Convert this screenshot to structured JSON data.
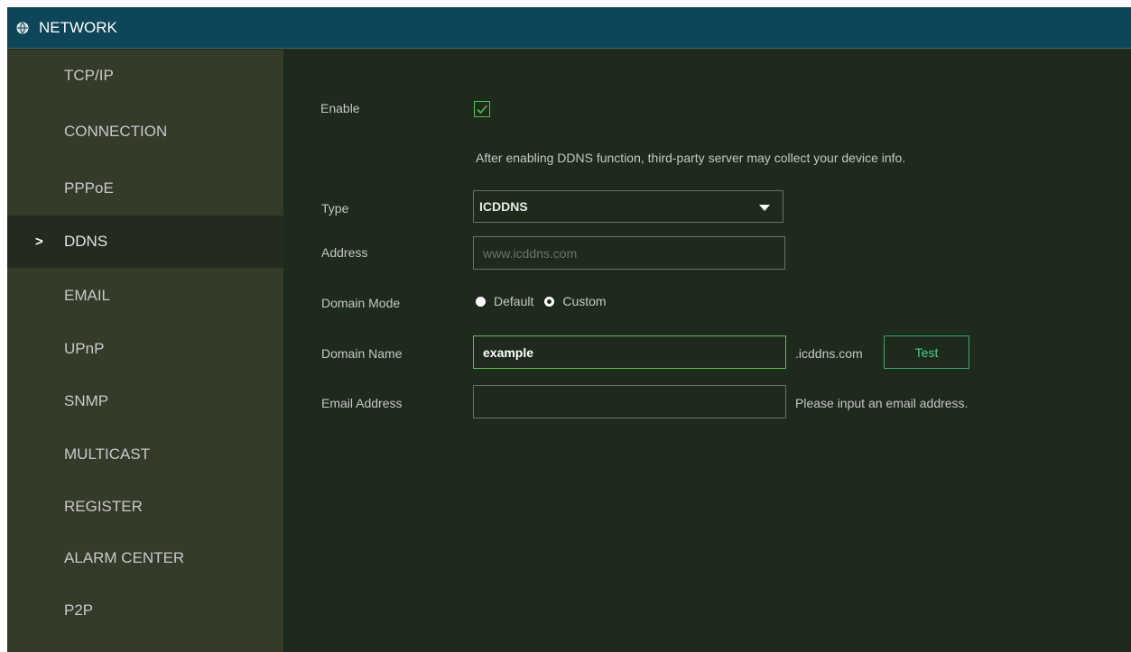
{
  "window": {
    "title": "NETWORK",
    "title_icon": "globe-icon"
  },
  "sidebar": {
    "active_index": 3,
    "items": [
      {
        "label": "TCP/IP"
      },
      {
        "label": "CONNECTION"
      },
      {
        "label": "PPPoE"
      },
      {
        "label": "DDNS"
      },
      {
        "label": "EMAIL"
      },
      {
        "label": "UPnP"
      },
      {
        "label": "SNMP"
      },
      {
        "label": "MULTICAST"
      },
      {
        "label": "REGISTER"
      },
      {
        "label": "ALARM CENTER"
      },
      {
        "label": "P2P"
      }
    ],
    "active_marker": ">"
  },
  "form": {
    "enable": {
      "label": "Enable",
      "checked": true
    },
    "notice": "After enabling DDNS function, third-party server may collect your device info.",
    "type": {
      "label": "Type",
      "value": "ICDDNS"
    },
    "address": {
      "label": "Address",
      "placeholder": "www.icddns.com",
      "value": ""
    },
    "domain_mode": {
      "label": "Domain Mode",
      "options": [
        "Default",
        "Custom"
      ],
      "selected": "Custom"
    },
    "domain_name": {
      "label": "Domain Name",
      "value": "example",
      "suffix": ".icddns.com",
      "test_label": "Test"
    },
    "email": {
      "label": "Email Address",
      "value": "",
      "hint": "Please input an email address."
    }
  },
  "colors": {
    "titlebar": "#0e4558",
    "sidebar": "#353b29",
    "main": "#1e2a1c",
    "accent_green": "#4ec24e",
    "button_text": "#4cd18b"
  }
}
